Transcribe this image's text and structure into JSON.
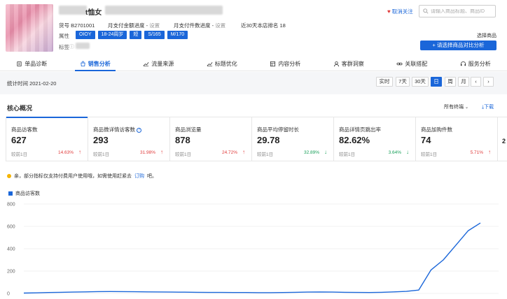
{
  "product": {
    "title_suffix": "t恤女",
    "item_no_label": "货号",
    "item_no": "B2701001",
    "pay_amount_label": "月支付金额进度 -",
    "pay_amount_link": "设置",
    "pay_count_label": "月支付件数进度 -",
    "pay_count_link": "设置",
    "rank_label": "近30天本店排名",
    "rank_value": "18",
    "attr_label": "属性",
    "tags": [
      "OIOY",
      "18-24周岁",
      "短",
      "S/165",
      "M/170"
    ],
    "tags_label": "标签",
    "colors": {
      "accent": "#1a66d9",
      "up": "#e03c3c",
      "down": "#19a05a"
    }
  },
  "actions": {
    "follow": "取消关注",
    "search_placeholder": "请输入商品标题、商品ID",
    "pick_label": "选择商品",
    "pick_button": "+ 请选择商品对比分析"
  },
  "tabs": [
    {
      "label": "单品诊断",
      "icon": "clipboard-icon"
    },
    {
      "label": "销售分析",
      "icon": "bag-icon",
      "active": true
    },
    {
      "label": "流量来源",
      "icon": "trend-icon"
    },
    {
      "label": "标题优化",
      "icon": "trend-icon"
    },
    {
      "label": "内容分析",
      "icon": "grid-icon"
    },
    {
      "label": "客群洞察",
      "icon": "user-icon"
    },
    {
      "label": "关联搭配",
      "icon": "link-icon"
    },
    {
      "label": "服务分析",
      "icon": "headset-icon"
    }
  ],
  "toolbar": {
    "stat_time_label": "统计时间",
    "stat_time": "2021-02-20",
    "ranges": [
      "实时",
      "7天",
      "30天",
      "日",
      "周",
      "月"
    ],
    "active_range": "日"
  },
  "section": {
    "title": "核心概况",
    "terminal": "所有终端",
    "download": "下载"
  },
  "cards": [
    {
      "label": "商品访客数",
      "value": "627",
      "compare": "较前1日",
      "pct": "14.63%",
      "dir": "up",
      "active": true
    },
    {
      "label": "商品微详情访客数",
      "value": "293",
      "compare": "较前1日",
      "pct": "31.98%",
      "dir": "up",
      "help": true
    },
    {
      "label": "商品浏览量",
      "value": "878",
      "compare": "较前1日",
      "pct": "24.72%",
      "dir": "up"
    },
    {
      "label": "商品平均停留时长",
      "value": "29.78",
      "compare": "较前1日",
      "pct": "32.89%",
      "dir": "down"
    },
    {
      "label": "商品详情页跳出率",
      "value": "82.62%",
      "compare": "较前1日",
      "pct": "3.64%",
      "dir": "down"
    },
    {
      "label": "商品加购件数",
      "value": "74",
      "compare": "较前1日",
      "pct": "5.71%",
      "dir": "up"
    },
    {
      "label": "",
      "value": "2",
      "compare": "",
      "pct": "",
      "dir": ""
    }
  ],
  "notice": {
    "text": "亲，部分指标仅支持付费用户使用哦，如需使用赶紧去",
    "link": "订购",
    "suffix": "吧。"
  },
  "chart_data": {
    "type": "line",
    "series": [
      {
        "name": "商品访客数",
        "values": [
          3,
          5,
          8,
          10,
          12,
          14,
          16,
          17,
          16,
          15,
          14,
          13,
          12,
          11,
          10,
          9,
          9,
          8,
          8,
          7,
          7,
          8,
          10,
          12,
          13,
          12,
          10,
          9,
          8,
          10,
          14,
          18,
          30,
          210,
          300,
          430,
          560,
          630
        ]
      }
    ],
    "y_ticks": [
      0,
      200,
      400,
      600,
      800
    ],
    "ylim": [
      0,
      800
    ],
    "grid": true,
    "legend": "top-left"
  }
}
